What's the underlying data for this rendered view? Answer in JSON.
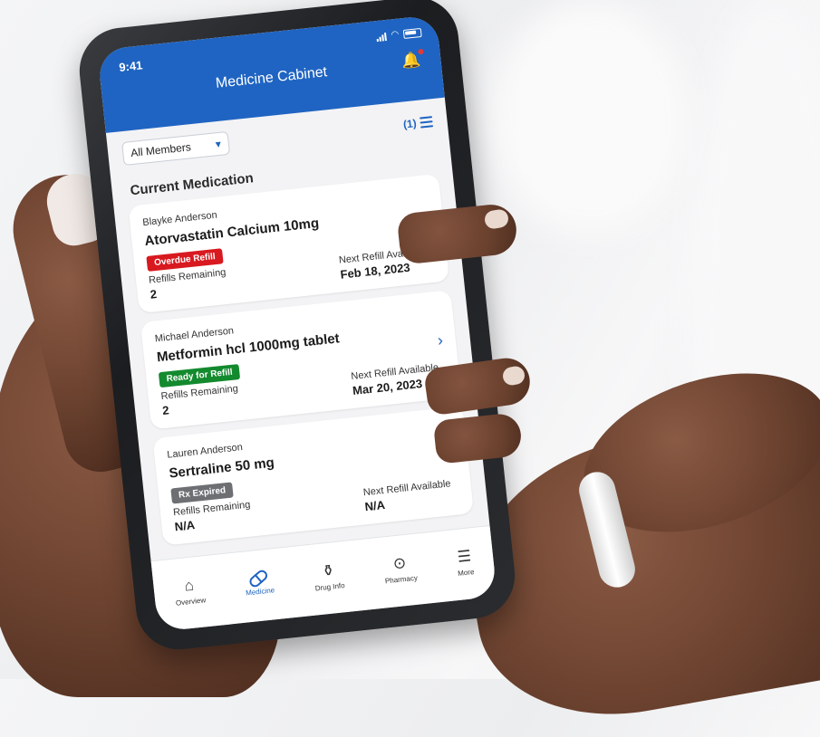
{
  "status_bar": {
    "time": "9:41"
  },
  "header": {
    "title": "Medicine Cabinet"
  },
  "filter": {
    "selected": "All Members",
    "count_label": "(1)"
  },
  "section": {
    "title": "Current Medication"
  },
  "cards": [
    {
      "patient": "Blayke Anderson",
      "drug": "Atorvastatin Calcium 10mg",
      "badge": "Overdue Refill",
      "badge_color": "#d8191f",
      "refills_label": "Refills Remaining",
      "refills_value": "2",
      "next_label": "Next Refill Available",
      "next_value": "Feb 18, 2023"
    },
    {
      "patient": "Michael Anderson",
      "drug": "Metformin hcl 1000mg tablet",
      "badge": "Ready for Refill",
      "badge_color": "#138a2e",
      "refills_label": "Refills Remaining",
      "refills_value": "2",
      "next_label": "Next Refill Available",
      "next_value": "Mar 20, 2023"
    },
    {
      "patient": "Lauren Anderson",
      "drug": "Sertraline 50 mg",
      "badge": "Rx Expired",
      "badge_color": "#6d6f73",
      "refills_label": "Refills Remaining",
      "refills_value": "N/A",
      "next_label": "Next Refill Available",
      "next_value": "N/A"
    }
  ],
  "tabs": [
    {
      "label": "Overview",
      "icon": "home-icon"
    },
    {
      "label": "Medicine",
      "icon": "pill-icon"
    },
    {
      "label": "Drug Info",
      "icon": "pill-bottle-icon"
    },
    {
      "label": "Pharmacy",
      "icon": "location-pin-icon"
    },
    {
      "label": "More",
      "icon": "menu-icon"
    }
  ],
  "colors": {
    "primary": "#1f64c2",
    "overdue": "#d8191f",
    "ready": "#138a2e",
    "expired": "#6d6f73"
  }
}
